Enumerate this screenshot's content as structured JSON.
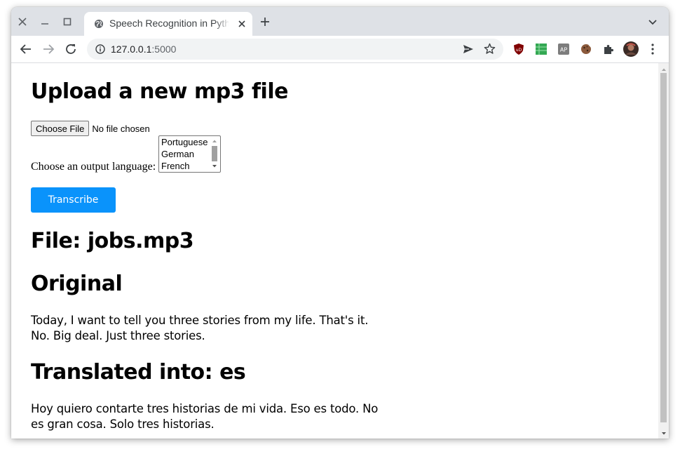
{
  "browser": {
    "tab_title": "Speech Recognition in Python",
    "url_host": "127.0.0.1",
    "url_port": ":5000"
  },
  "page": {
    "upload_heading": "Upload a new mp3 file",
    "choose_file_label": "Choose File",
    "no_file_text": "No file chosen",
    "language_label": "Choose an output language:",
    "language_options": [
      "Portuguese",
      "German",
      "French"
    ],
    "transcribe_button": "Transcribe",
    "file_heading": "File: jobs.mp3",
    "original_heading": "Original",
    "original_text": "Today, I want to tell you three stories from my life. That's it. No. Big deal. Just three stories.",
    "translated_heading": "Translated into: es",
    "translated_text": "Hoy quiero contarte tres historias de mi vida. Eso es todo. No es gran cosa. Solo tres historias."
  },
  "colors": {
    "accent": "#0a93fb",
    "tabstrip": "#dee1e6",
    "omnibox": "#f1f3f4"
  },
  "icons": {
    "window_controls": [
      "close-icon",
      "minimize-icon",
      "maximize-icon"
    ],
    "toolbar": [
      "back-icon",
      "forward-icon",
      "reload-icon",
      "info-icon",
      "send-icon",
      "star-icon",
      "puzzle-icon",
      "menu-icon"
    ],
    "extensions": [
      "ublock-icon",
      "sheets-extension-icon",
      "ap-extension-icon",
      "cookie-icon"
    ]
  }
}
